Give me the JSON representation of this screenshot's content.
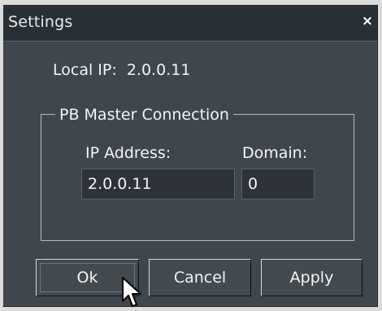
{
  "window": {
    "title": "Settings",
    "close_symbol": "×"
  },
  "info": {
    "local_ip_label": "Local IP:",
    "local_ip_value": "2.0.0.11"
  },
  "connection": {
    "group_title": "PB Master Connection",
    "ip_address_label": "IP Address:",
    "ip_address_value": "2.0.0.11",
    "domain_label": "Domain:",
    "domain_value": "0"
  },
  "buttons": {
    "ok_label": "Ok",
    "cancel_label": "Cancel",
    "apply_label": "Apply"
  },
  "icons": {
    "close": "close-icon",
    "cursor": "mouse-pointer-icon"
  },
  "colors": {
    "window_background": "#3f464d",
    "titlebar_background": "#283036",
    "text": "#f4f4f4"
  }
}
